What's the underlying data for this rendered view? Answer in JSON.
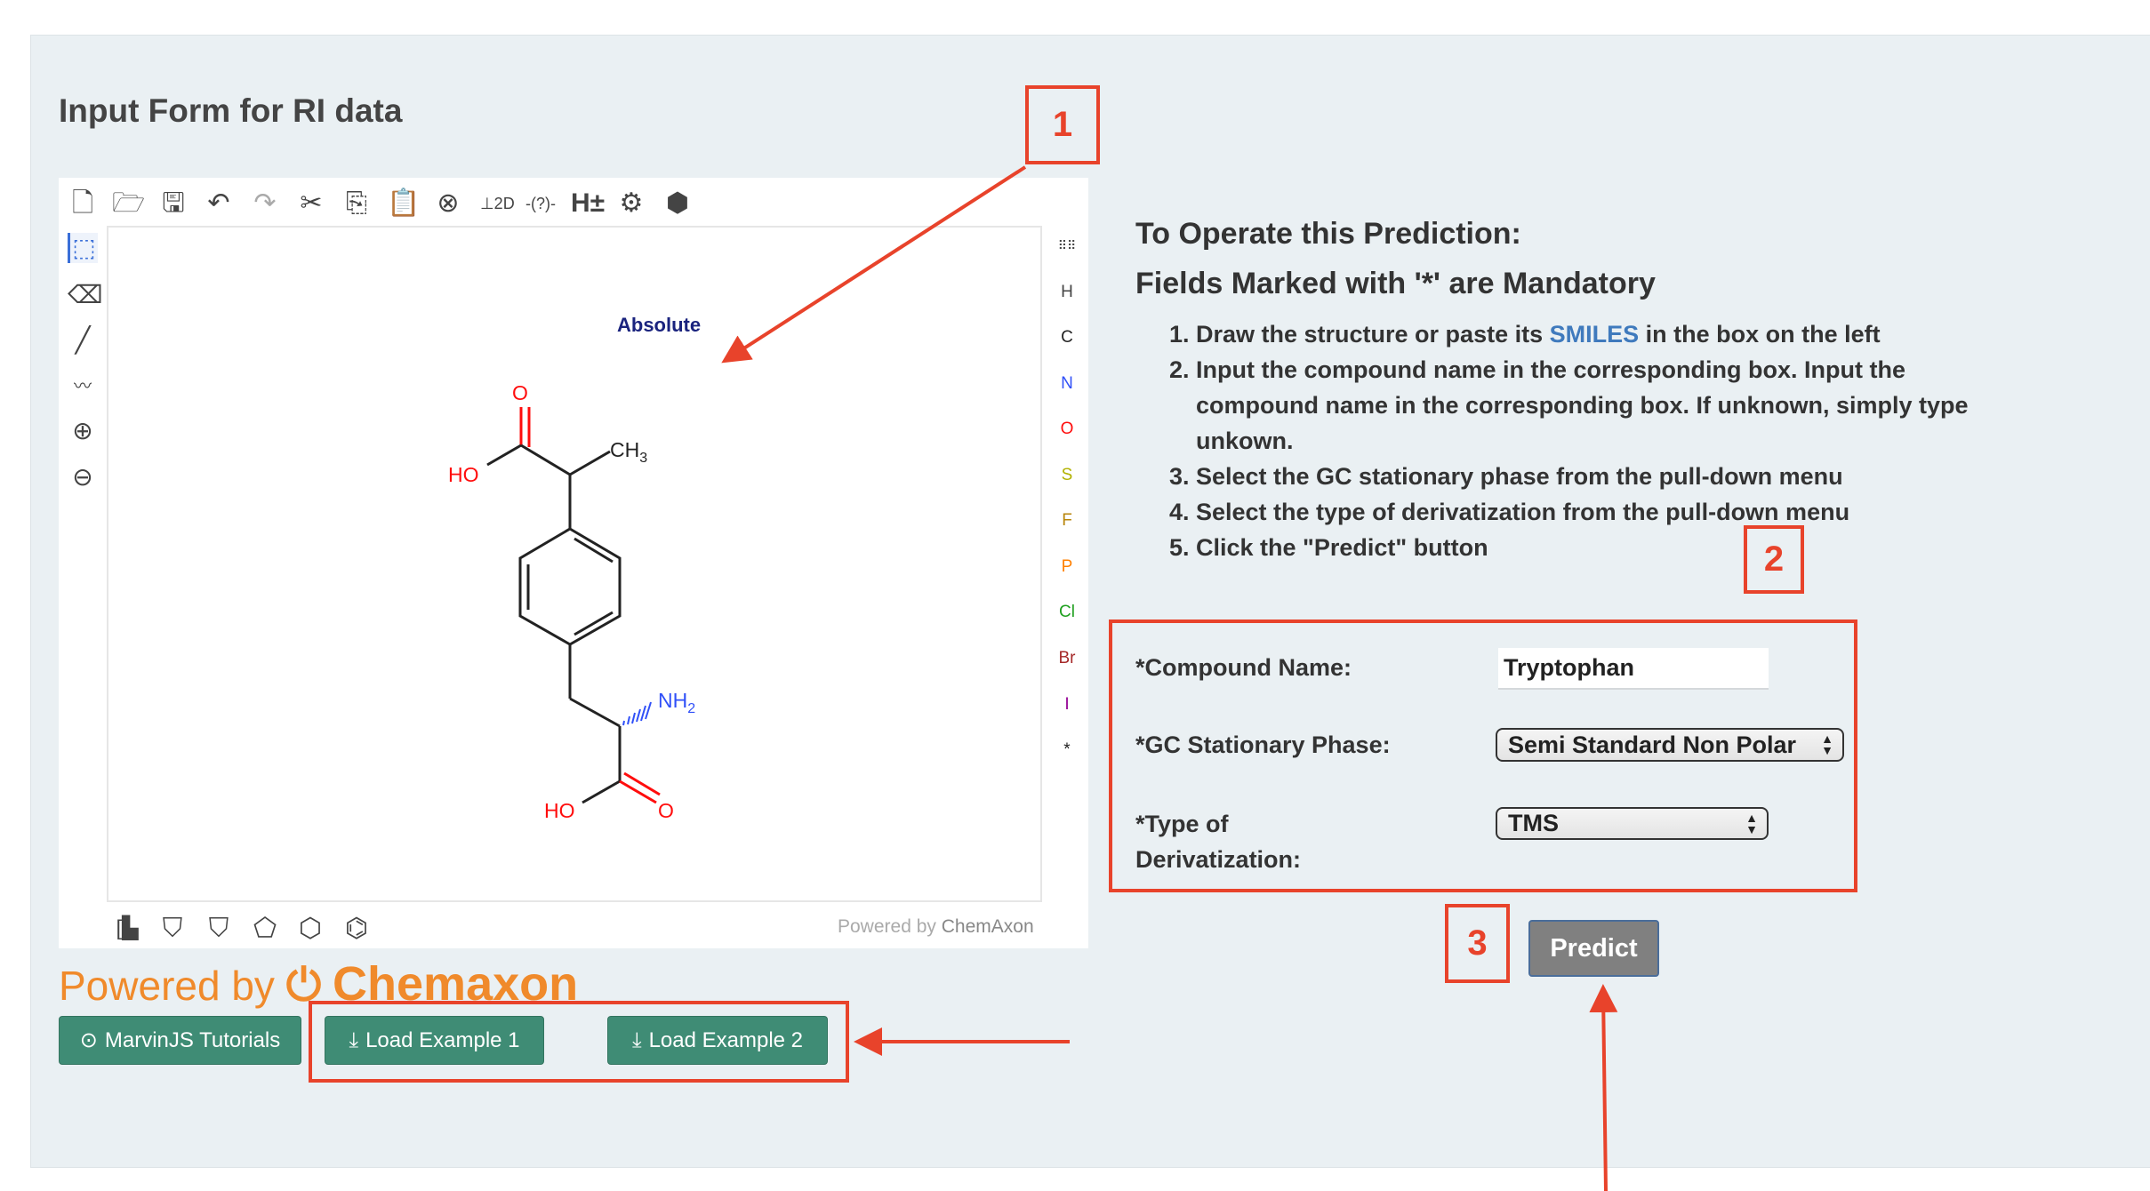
{
  "page": {
    "title": "Input Form for RI data"
  },
  "editor": {
    "toolbar": [
      "new-document",
      "open-folder",
      "save",
      "undo",
      "redo",
      "cut",
      "copy",
      "paste",
      "zoom",
      "clean-2d",
      "query",
      "add-remove-hydrogens",
      "settings",
      "info"
    ],
    "left_tools": [
      "select",
      "erase",
      "single-bond",
      "chain",
      "increase-charge",
      "decrease-charge"
    ],
    "atoms": [
      "H",
      "C",
      "N",
      "O",
      "S",
      "F",
      "P",
      "Cl",
      "Br",
      "I",
      "*"
    ],
    "atom_colors": {
      "H": "#444444",
      "C": "#222222",
      "N": "#3050f8",
      "O": "#ff0d0d",
      "S": "#b2b200",
      "F": "#b8860b",
      "P": "#ff8000",
      "Cl": "#1fa01f",
      "Br": "#a62929",
      "I": "#940094",
      "*": "#222222"
    },
    "templates": [
      "bracket",
      "aromatic-ring-n",
      "cyclopropane",
      "cyclopentane",
      "cyclohexane",
      "benzene"
    ],
    "canvas": {
      "chirality_label": "Absolute",
      "atom_labels": {
        "o1": "O",
        "ho1": "HO",
        "ch3": "CH",
        "ch3_sub": "3",
        "nh2": "NH",
        "nh2_sub": "2",
        "ho2": "HO",
        "o2": "O"
      }
    },
    "powered_prefix": "Powered by ",
    "powered_brand": "ChemAxon"
  },
  "logo": {
    "prefix": "Powered by",
    "brand": "Chemaxon"
  },
  "buttons": {
    "tutorials": "MarvinJS Tutorials",
    "example1": "Load Example 1",
    "example2": "Load Example 2",
    "predict": "Predict"
  },
  "annotations": {
    "one": "1",
    "two": "2",
    "three": "3"
  },
  "annotation_color": "#e8432b",
  "instructions": {
    "heading1": "To Operate this Prediction:",
    "heading2": "Fields Marked with '*' are Mandatory",
    "step1_pre": "Draw the structure or paste its ",
    "step1_link": "SMILES",
    "step1_post": " in the box on the left",
    "step2": "Input the compound name in the corresponding box. Input the compound name in the corresponding box. If unknown, simply type unkown.",
    "step3": "Select the GC stationary phase from the pull-down menu",
    "step4": "Select the type of derivatization from the pull-down menu",
    "step5": "Click the \"Predict\" button"
  },
  "form": {
    "compound_label": "*Compound Name:",
    "compound_value": "Tryptophan",
    "phase_label": "*GC Stationary Phase:",
    "phase_value": "Semi Standard Non Polar",
    "deriv_label1": "*Type of",
    "deriv_label2": "Derivatization:",
    "deriv_value": "TMS"
  }
}
